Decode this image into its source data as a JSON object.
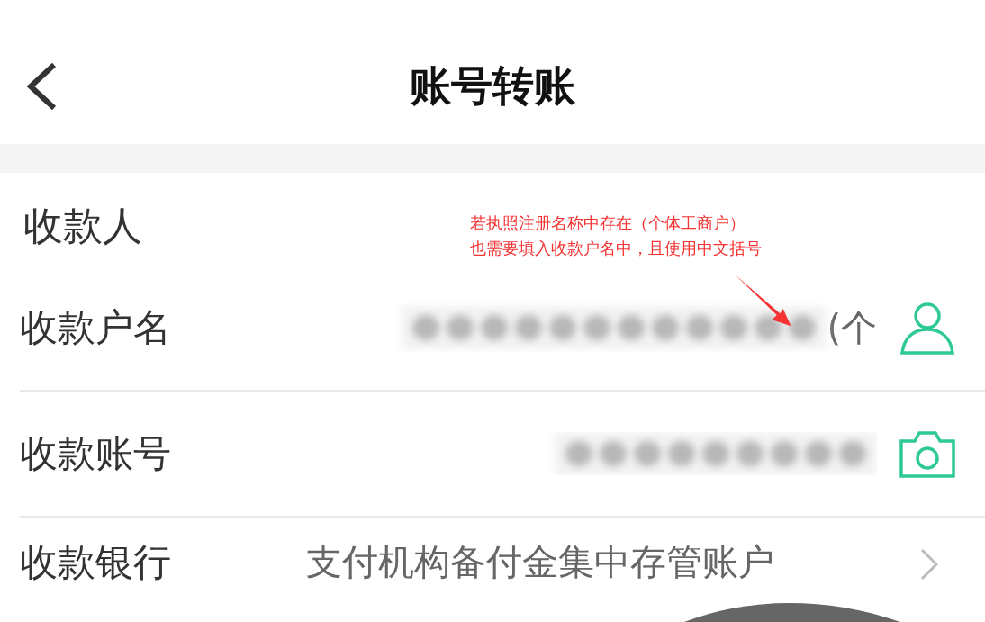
{
  "header": {
    "title": "账号转账"
  },
  "section": {
    "title": "收款人"
  },
  "fields": [
    {
      "kind": "name",
      "label": "收款户名",
      "value": "(个"
    },
    {
      "kind": "account",
      "label": "收款账号"
    },
    {
      "kind": "bank",
      "label": "收款银行",
      "value": "支付机构备付金集中存管账户"
    }
  ],
  "annotation": {
    "lines": [
      "若执照注册名称中存在（个体工商户）",
      "也需要填入收款户名中，且使用中文括号"
    ]
  }
}
